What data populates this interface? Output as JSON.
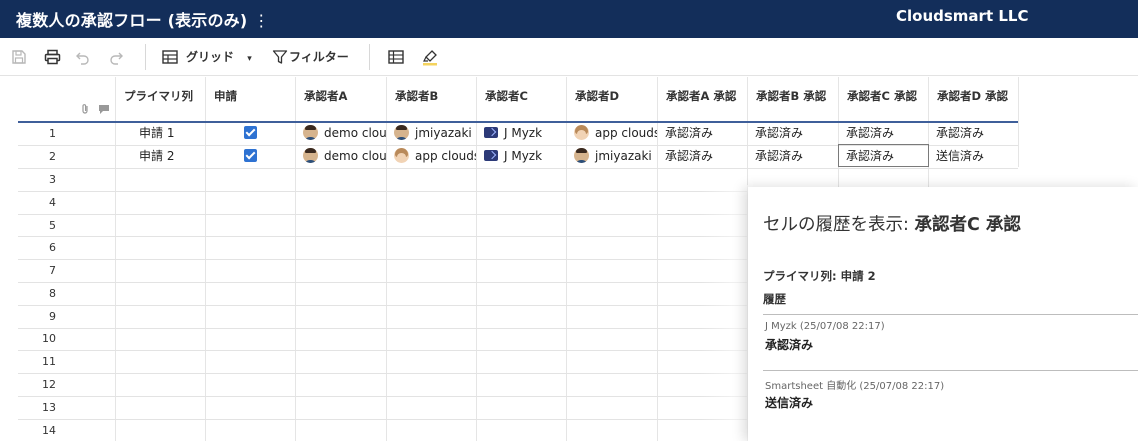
{
  "header": {
    "sheet_title": "複数人の承認フロー (表示のみ)",
    "kebab": "⋮",
    "company": "Cloudsmart LLC",
    "bg_color": "#132e5a"
  },
  "toolbar": {
    "save_icon": "save-icon",
    "print_icon": "print-icon",
    "undo_icon": "undo-icon",
    "redo_icon": "redo-icon",
    "grid_label": "グリッド",
    "grid_caret": "▾",
    "filter_label": "フィルター",
    "column_settings_icon": "column-settings-icon",
    "highlight_icon": "highlighter-icon"
  },
  "grid": {
    "columns": [
      "プライマリ列",
      "申請",
      "承認者A",
      "承認者B",
      "承認者C",
      "承認者D",
      "承認者A 承認",
      "承認者B 承認",
      "承認者C 承認",
      "承認者D 承認"
    ],
    "rows": [
      {
        "num": "1",
        "primary": "申請 1",
        "checked": true,
        "approver_a": {
          "name": "demo clou",
          "avatar": "man"
        },
        "approver_b": {
          "name": "jmiyazaki",
          "avatar": "man"
        },
        "approver_c": {
          "name": "J Myzk",
          "avatar": "bot"
        },
        "approver_d": {
          "name": "app clouds",
          "avatar": "woman"
        },
        "status_a": "承認済み",
        "status_b": "承認済み",
        "status_c": "承認済み",
        "status_d": "承認済み"
      },
      {
        "num": "2",
        "primary": "申請 2",
        "checked": true,
        "approver_a": {
          "name": "demo clou",
          "avatar": "man"
        },
        "approver_b": {
          "name": "app clouds",
          "avatar": "woman"
        },
        "approver_c": {
          "name": "J Myzk",
          "avatar": "bot"
        },
        "approver_d": {
          "name": "jmiyazaki",
          "avatar": "man"
        },
        "status_a": "承認済み",
        "status_b": "承認済み",
        "status_c": "承認済み",
        "status_d": "送信済み"
      }
    ],
    "empty_row_numbers": [
      "3",
      "4",
      "5",
      "6",
      "7",
      "8",
      "9",
      "10",
      "11",
      "12",
      "13",
      "14"
    ],
    "checkbox_color": "#2e72d2"
  },
  "history_panel": {
    "title_prefix": "セルの履歴を表示: ",
    "title_column": "承認者C 承認",
    "primary_label": "プライマリ列: 申請 2",
    "history_label": "履歴",
    "entries": [
      {
        "meta": "J Myzk (25/07/08 22:17)",
        "value": "承認済み"
      },
      {
        "meta": "Smartsheet 自動化 (25/07/08 22:17)",
        "value": "送信済み"
      }
    ]
  }
}
